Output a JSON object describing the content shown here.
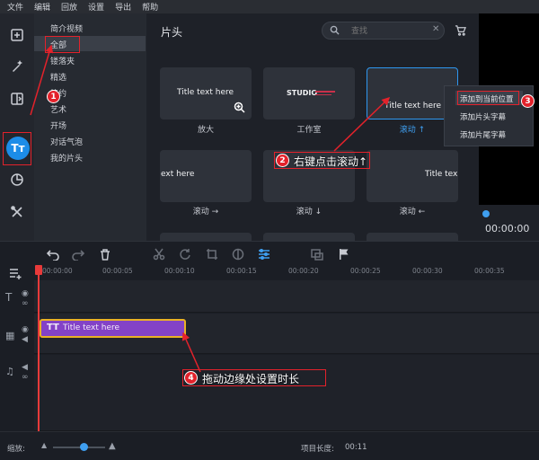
{
  "menubar": [
    "文件",
    "编辑",
    "回放",
    "设置",
    "导出",
    "帮助"
  ],
  "categories": [
    "简介视频",
    "全部",
    "镂落夹",
    "精选",
    "简约",
    "艺术",
    "开场",
    "对话气泡",
    "我的片头"
  ],
  "content": {
    "title": "片头",
    "search_placeholder": "查找",
    "thumbs": [
      {
        "text": "Title text here",
        "label": "放大"
      },
      {
        "text": "STUDIO",
        "label": "工作室"
      },
      {
        "text": "Title text here",
        "label": "滚动 ↑"
      },
      {
        "text": "ext here",
        "label": "滚动 →"
      },
      {
        "text": "Title text here",
        "label": "滚动 ↓"
      },
      {
        "text": "Title tex",
        "label": "滚动 ←"
      }
    ]
  },
  "context_menu": [
    "添加到当前位置",
    "添加片头字幕",
    "添加片尾字幕"
  ],
  "preview": {
    "time": "00:00:00"
  },
  "timeline": {
    "ticks": [
      "00:00:00",
      "00:00:05",
      "00:00:10",
      "00:00:15",
      "00:00:20",
      "00:00:25",
      "00:00:30",
      "00:00:35"
    ],
    "clip_label": "Title text here",
    "clip_icon": "TT"
  },
  "status": {
    "zoom_label": "缩放:",
    "project_length_label": "项目长度:",
    "project_length": "00:11"
  },
  "callouts": {
    "c1": "1",
    "c2": "2",
    "c2_text": "右键点击滚动↑",
    "c3": "3",
    "c4": "4",
    "c4_text": "拖动边缘处设置时长"
  },
  "colors": {
    "accent": "#1c8de8",
    "clip": "#8342c7",
    "clip_border": "#e9b126",
    "callout": "#e3222b"
  }
}
